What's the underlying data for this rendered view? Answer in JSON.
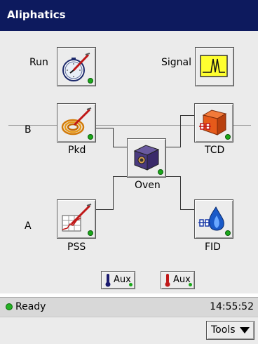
{
  "window": {
    "title": "Aliphatics"
  },
  "top_controls": {
    "run_label": "Run",
    "signal_label": "Signal"
  },
  "flow": {
    "pkd_label": "Pkd",
    "pss_label": "PSS",
    "oven_label": "Oven",
    "tcd_label": "TCD",
    "fid_label": "FID",
    "front_label": "B",
    "back_label": "A"
  },
  "aux": [
    {
      "label": "Aux",
      "icon": "thermometer-blue-icon",
      "color": "#1a1a6e"
    },
    {
      "label": "Aux",
      "icon": "thermometer-red-icon",
      "color": "#c01818"
    }
  ],
  "status": {
    "text": "Ready",
    "indicator_color": "#24b024",
    "time": "14:55:52"
  },
  "toolbar": {
    "tools_label": "Tools"
  }
}
